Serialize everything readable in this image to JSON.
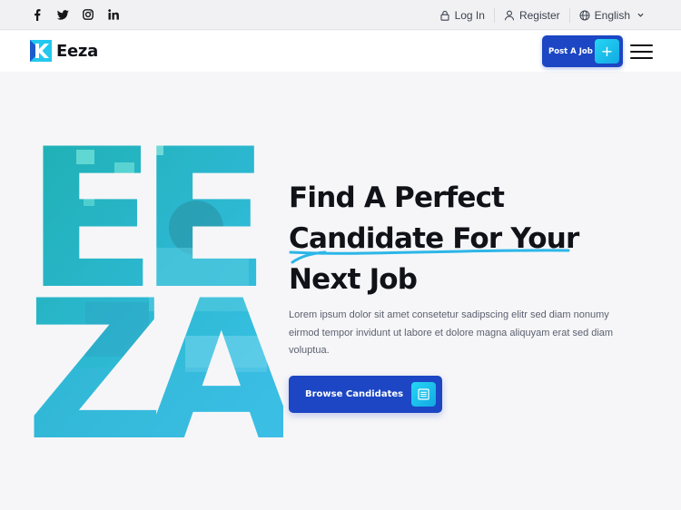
{
  "topbar": {
    "social": [
      {
        "icon": "facebook-icon",
        "glyph": "f"
      },
      {
        "icon": "twitter-icon",
        "glyph": "🐦"
      },
      {
        "icon": "instagram-icon",
        "glyph": "◎"
      },
      {
        "icon": "linkedin-icon",
        "glyph": "in"
      }
    ],
    "login_label": "Log In",
    "register_label": "Register",
    "language_label": "English"
  },
  "nav": {
    "brand": "Eeza",
    "post_job_label": "Post A Job",
    "post_job_plus": "+"
  },
  "hero": {
    "letters": "EEZA",
    "title_line1": "Find A Perfect",
    "title_line2": "Candidate For Your",
    "title_line3": "Next Job",
    "description": "Lorem ipsum dolor sit amet consetetur sadipscing elitr sed diam nonumy eirmod tempor invidunt ut labore et dolore magna aliquyam erat sed diam voluptua.",
    "browse_label": "Browse Candidates"
  },
  "colors": {
    "primary_blue": "#1c46c3",
    "accent_cyan": "#22c8ee",
    "underline": "#2cb6e8",
    "text_dark": "#111218"
  }
}
